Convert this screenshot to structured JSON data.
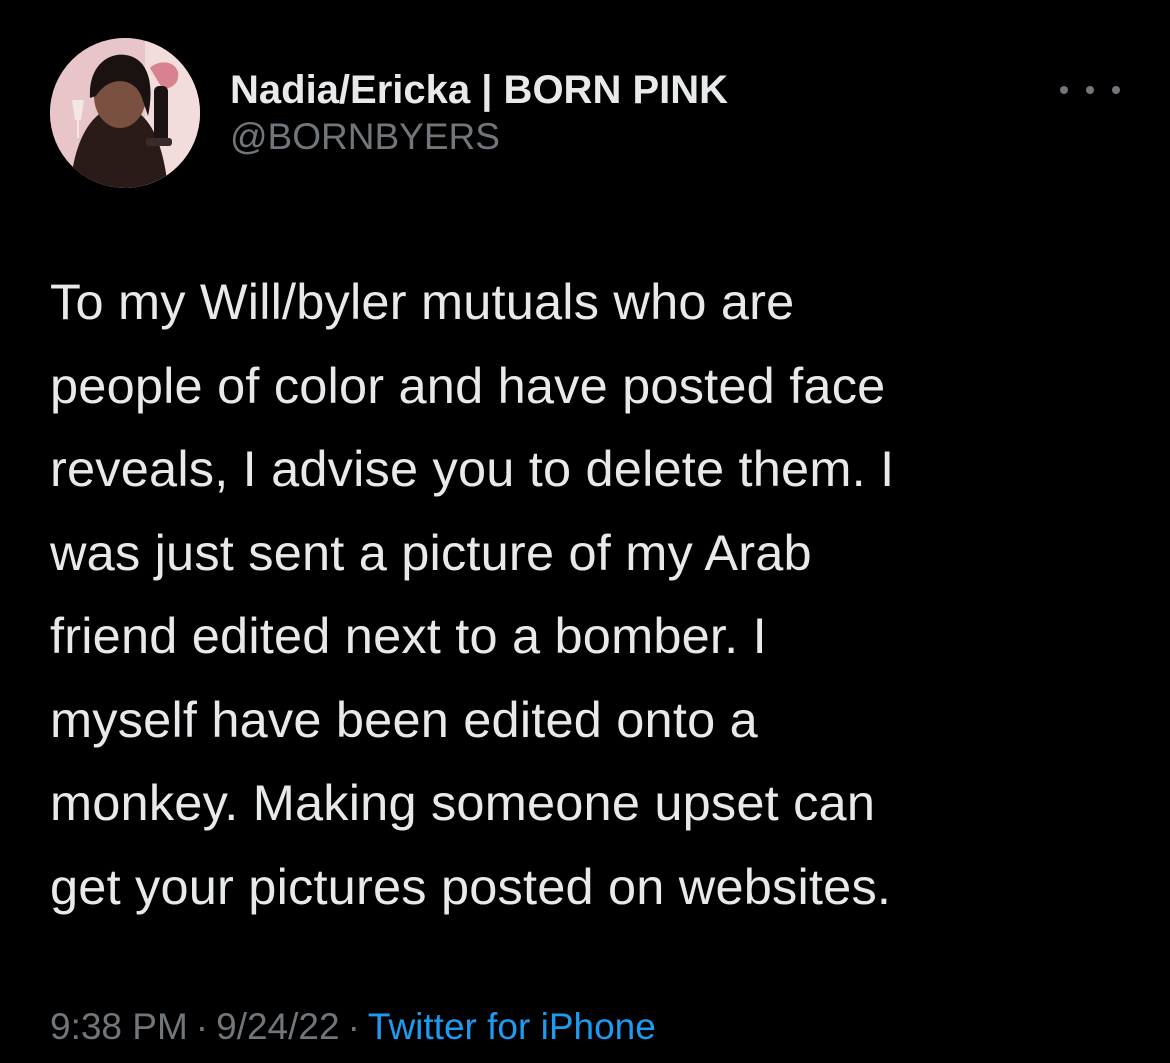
{
  "author": {
    "display_name": "Nadia/Ericka | BORN PINK",
    "handle": "@BORNBYERS",
    "avatar_icon": "profile-photo"
  },
  "more_icon": "ellipsis-icon",
  "tweet": {
    "lines": [
      "To my Will/byler mutuals who are",
      "people of color and have posted face",
      "reveals, I advise you to delete them. I",
      "was just sent a picture of my Arab",
      "friend edited next to a bomber. I",
      "myself have been edited onto a",
      "monkey. Making someone upset can",
      "get your pictures posted on websites."
    ]
  },
  "meta": {
    "time": "9:38 PM",
    "separator": "·",
    "date": "9/24/22",
    "source": "Twitter for iPhone"
  },
  "colors": {
    "background": "#000000",
    "text": "#e7e9ea",
    "secondary": "#71767b",
    "link": "#1d9bf0"
  }
}
